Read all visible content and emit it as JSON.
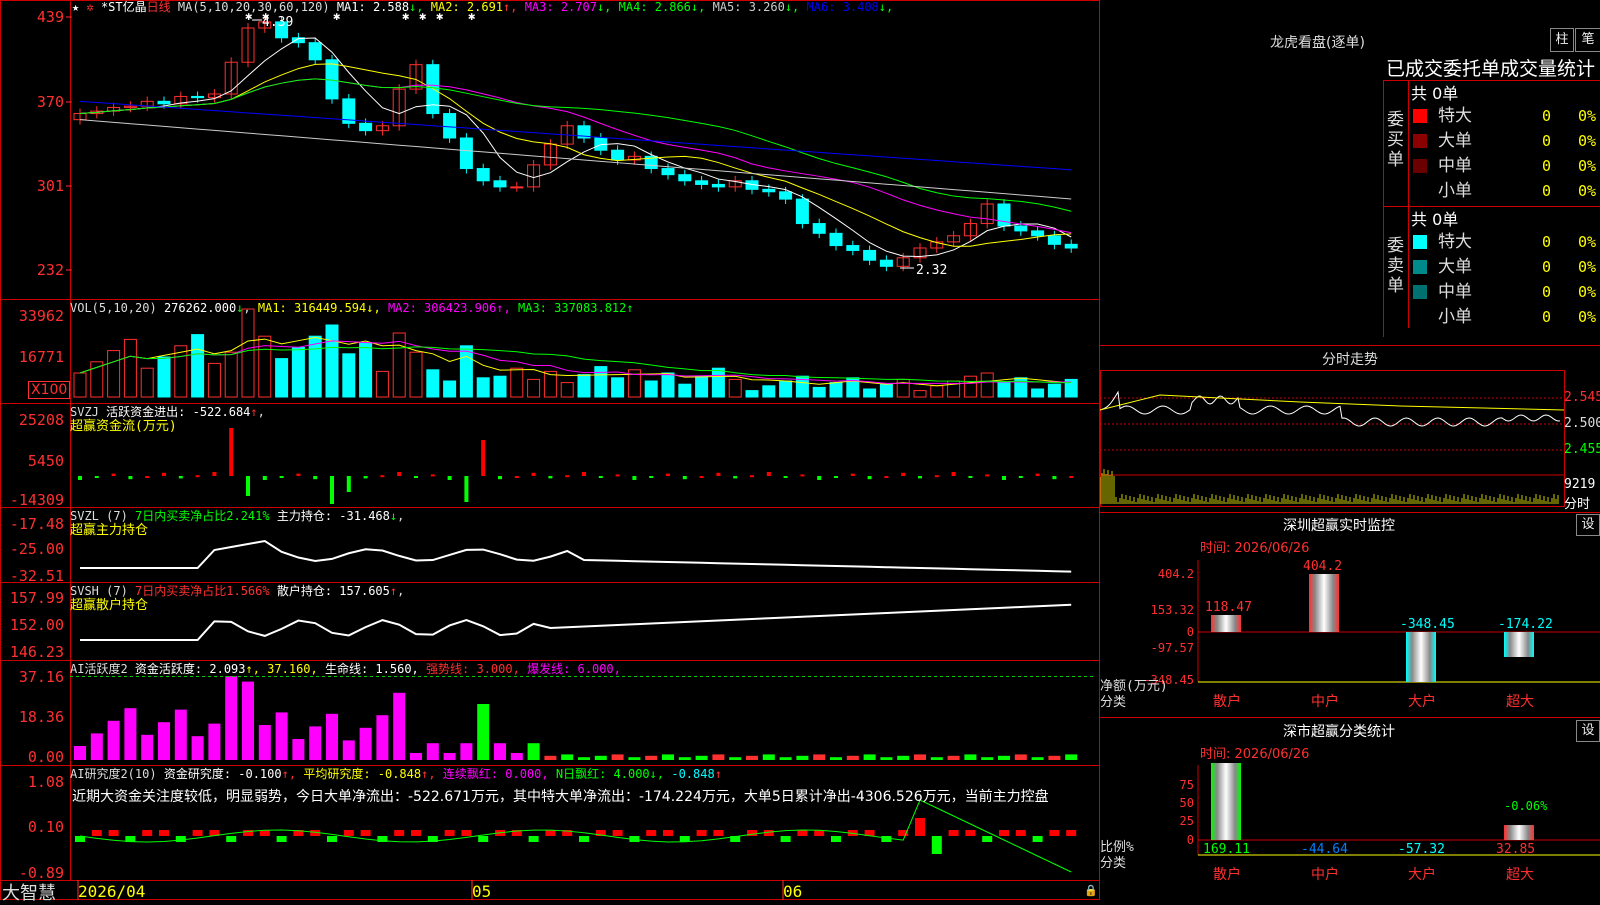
{
  "stock": {
    "name": "*ST亿晶",
    "period": "日线",
    "ma_label": "MA(5,10,20,30,60,120)",
    "ma_values": [
      {
        "label": "MA1:",
        "value": "2.588",
        "arrow": "↓",
        "color": "#ffffff"
      },
      {
        "label": "MA2:",
        "value": "2.691",
        "arrow": "↑",
        "color": "#ffff00"
      },
      {
        "label": "MA3:",
        "value": "2.707",
        "arrow": "↓",
        "color": "#ff00ff"
      },
      {
        "label": "MA4:",
        "value": "2.866",
        "arrow": "↓",
        "color": "#00ff00"
      },
      {
        "label": "MA5:",
        "value": "3.260",
        "arrow": "↓",
        "color": "#cccccc"
      },
      {
        "label": "MA6:",
        "value": "3.408",
        "arrow": "↓",
        "color": "#0000ff"
      }
    ],
    "high_label": "4.39",
    "low_label": "2.32",
    "price_ticks": [
      "439",
      "370",
      "301",
      "232"
    ]
  },
  "vol_panel": {
    "title": "VOL(5,10,20)",
    "value": "276262.000",
    "value_arrow": "↓",
    "ma1": "MA1: 316449.594↓,",
    "ma2": "MA2: 306423.906↑,",
    "ma3": "MA3: 337083.812↑",
    "ticks": [
      "33962",
      "16771"
    ],
    "unit": "X100"
  },
  "svzj_panel": {
    "title": "SVZJ",
    "text": "活跃资金进出: -522.684",
    "arrow": "↑",
    "subtitle": "超赢资金流(万元)",
    "ticks": [
      "25208",
      "5450",
      "-14309"
    ]
  },
  "svzl_panel": {
    "title": "SVZL (7)",
    "text1": "7日内买卖净占比2.241%",
    "text2": "主力持仓: -31.468",
    "arrow": "↓",
    "subtitle": "超赢主力持仓",
    "ticks": [
      "-17.48",
      "-25.00",
      "-32.51"
    ]
  },
  "svsh_panel": {
    "title": "SVSH (7)",
    "text1": "7日内买卖净占比1.566%",
    "text2": "散户持仓: 157.605",
    "arrow": "↑",
    "subtitle": "超赢散户持仓",
    "ticks": [
      "157.99",
      "152.00",
      "146.23"
    ]
  },
  "ai_active_panel": {
    "title": "AI活跃度2",
    "t1": "资金活跃度: 2.093",
    "t2": "↑, 37.160,",
    "t3": "生命线: 1.560,",
    "t4": "强势线: 3.000,",
    "t5": "爆发线: 6.000,",
    "ticks": [
      "37.16",
      "18.36",
      "0.00"
    ]
  },
  "ai_research_panel": {
    "title": "AI研究度2(10)",
    "t1": "资金研究度: -0.100",
    "t2": "平均研究度: -0.848",
    "t3": "连续飘红: 0.000,",
    "t4": "N日飘红: 4.000",
    "t5": "-0.848",
    "comment": "近期大资金关注度较低，明显弱势，今日大单净流出：-522.671万元，其中特大单净流出：-174.224万元，大单5日累计净出-4306.526万元，当前主力控盘",
    "ticks": [
      "1.08",
      "0.10",
      "-0.89"
    ]
  },
  "date_axis": [
    "2026/04",
    "05",
    "06"
  ],
  "brand": "大智慧",
  "right_panel": {
    "dragon_title": "龙虎看盘(逐单)",
    "btn_zhu": "柱",
    "btn_bi": "笔",
    "stat_title": "已成交委托单成交量统计",
    "buy": {
      "side_label": "委买单",
      "total": "共 0单",
      "rows": [
        {
          "label": "特大",
          "value": "0",
          "pct": "0%",
          "color": "#ff0000"
        },
        {
          "label": "大单",
          "value": "0",
          "pct": "0%",
          "color": "#8b0000"
        },
        {
          "label": "中单",
          "value": "0",
          "pct": "0%",
          "color": "#6b0000"
        },
        {
          "label": "小单",
          "value": "0",
          "pct": "0%",
          "color": ""
        }
      ]
    },
    "sell": {
      "side_label": "委卖单",
      "total": "共 0单",
      "rows": [
        {
          "label": "特大",
          "value": "0",
          "pct": "0%",
          "color": "#00ffff"
        },
        {
          "label": "大单",
          "value": "0",
          "pct": "0%",
          "color": "#008b8b"
        },
        {
          "label": "中单",
          "value": "0",
          "pct": "0%",
          "color": "#007070"
        },
        {
          "label": "小单",
          "value": "0",
          "pct": "0%",
          "color": ""
        }
      ]
    },
    "intraday_title": "分时走势",
    "intraday_ticks": [
      "2.545",
      "2.500",
      "2.455"
    ],
    "intraday_vol": "9219",
    "intraday_vol_unit": "分时",
    "monitor": {
      "title": "深圳超赢实时监控",
      "btn": "设",
      "time": "时间: 2026/06/26",
      "ticks": [
        "404.2",
        "153.32",
        "0",
        "-97.57",
        "-348.45"
      ],
      "ylabel": "净额(万元)",
      "xlabel": "分类",
      "categories": [
        "散户",
        "中户",
        "大户",
        "超大"
      ],
      "values": [
        118.47,
        404.2,
        -348.45,
        -174.22
      ],
      "value_labels": [
        "118.47",
        "404.2",
        "-348.45",
        "-174.22"
      ]
    },
    "classify": {
      "title": "深市超赢分类统计",
      "btn": "设",
      "time": "时间: 2026/06/26",
      "ticks": [
        "75",
        "50",
        "25",
        "0"
      ],
      "ylabel": "比例%",
      "xlabel": "分类",
      "categories": [
        "散户",
        "中户",
        "大户",
        "超大"
      ],
      "values": [
        169.11,
        -44.64,
        -57.32,
        32.85
      ],
      "value_labels": [
        "169.11",
        "-44.64",
        "-57.32",
        "32.85"
      ],
      "extra_label": "-0.06%"
    }
  },
  "colors": {
    "up": "#ff3030",
    "down": "#00ffff",
    "grid": "#cc0000",
    "pos": "#ff0000",
    "neg": "#00ff00",
    "magenta": "#ff00ff"
  }
}
